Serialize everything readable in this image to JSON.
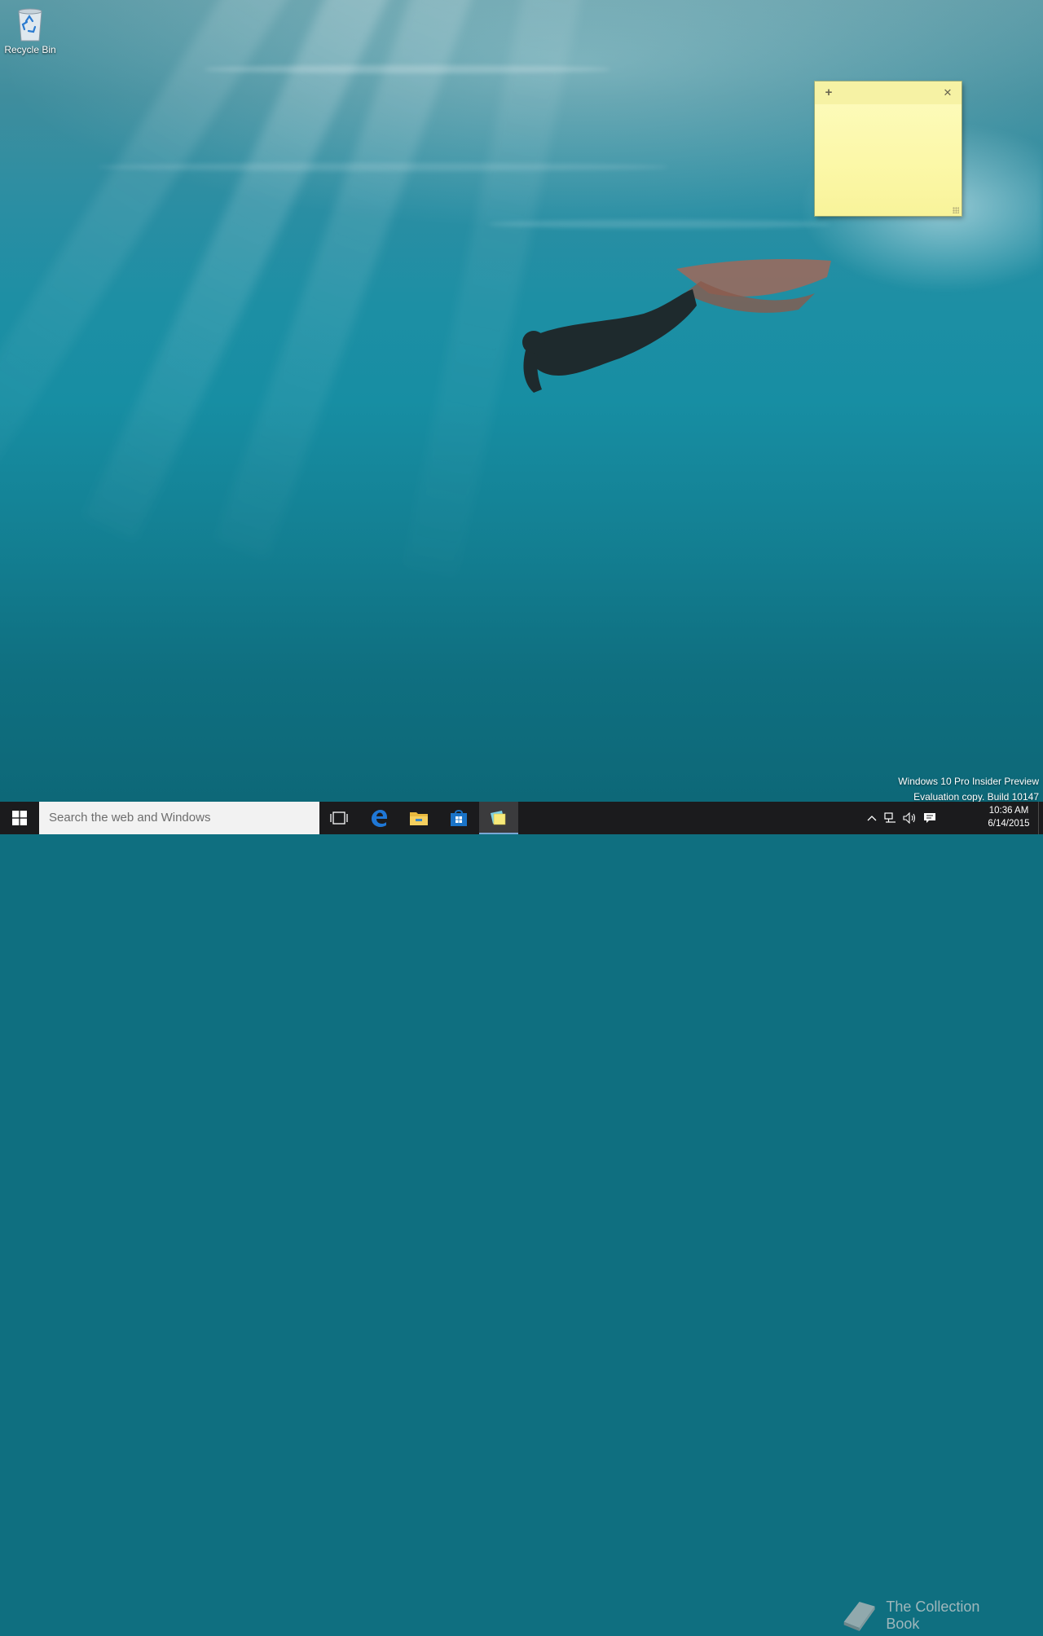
{
  "desktop": {
    "icons": [
      {
        "label": "Recycle Bin",
        "icon": "recycle-bin-icon"
      }
    ]
  },
  "sticky_note": {
    "add_glyph": "+",
    "close_glyph": "✕",
    "content": "",
    "color": "#fcf8a8"
  },
  "watermark": {
    "line1": "Windows 10 Pro Insider Preview",
    "line2": "Evaluation copy. Build 10147"
  },
  "overlay_logo": {
    "text": "The Collection Book",
    "icon": "book-icon"
  },
  "taskbar": {
    "search_placeholder": "Search the web and Windows",
    "buttons": [
      {
        "name": "task-view",
        "icon": "task-view-icon"
      },
      {
        "name": "edge",
        "icon": "edge-icon"
      },
      {
        "name": "file-explorer",
        "icon": "folder-icon"
      },
      {
        "name": "store",
        "icon": "store-icon"
      },
      {
        "name": "sticky-notes",
        "icon": "sticky-notes-icon",
        "active": true
      }
    ],
    "tray": {
      "icons": [
        "chevron-up-icon",
        "network-icon",
        "volume-icon",
        "action-center-icon"
      ],
      "time": "10:36 AM",
      "date": "6/14/2015"
    },
    "accent_color": "#79a8d6"
  }
}
